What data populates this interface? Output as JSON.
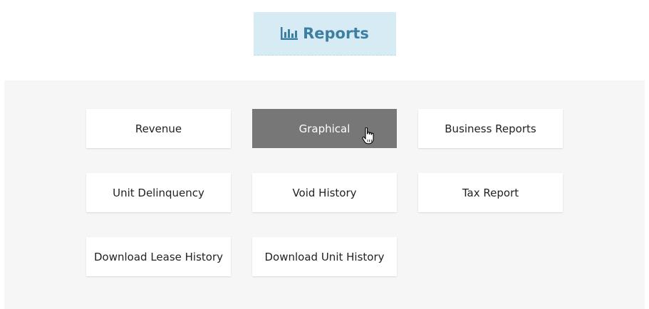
{
  "header": {
    "title": "Reports",
    "icon": "bar-chart-icon",
    "color": "#3d7fa3",
    "background": "#d7ebf5"
  },
  "reports": {
    "revenue": "Revenue",
    "graphical": "Graphical",
    "business_reports": "Business Reports",
    "unit_delinquency": "Unit Delinquency",
    "void_history": "Void History",
    "tax_report": "Tax Report",
    "download_lease_history": "Download Lease History",
    "download_unit_history": "Download Unit History"
  },
  "active_item": "graphical",
  "active_color": "#777777"
}
